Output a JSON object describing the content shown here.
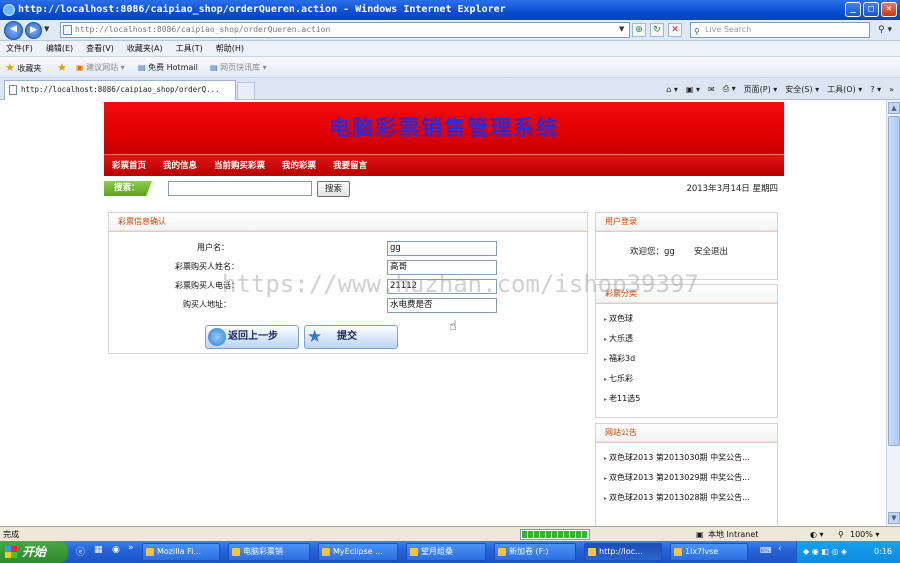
{
  "window": {
    "title": "http://localhost:8086/caipiao_shop/orderQueren.action - Windows Internet Explorer",
    "address": "http://localhost:8086/caipiao_shop/orderQueren.action",
    "search_placeholder": "Live Search"
  },
  "menu": [
    "文件(F)",
    "编辑(E)",
    "查看(V)",
    "收藏夹(A)",
    "工具(T)",
    "帮助(H)"
  ],
  "favorites": {
    "label": "收藏夹",
    "items": [
      "建议网站 ▾",
      "免费 Hotmail",
      "网页快讯库 ▾"
    ]
  },
  "tab": {
    "title": "http://localhost:8086/caipiao_shop/orderQ..."
  },
  "commands": [
    "页面(P) ▾",
    "安全(S) ▾",
    "工具(O) ▾"
  ],
  "site": {
    "title": "电脑彩票销售管理系统",
    "nav": [
      "彩票首页",
      "我的信息",
      "当前购买彩票",
      "我的彩票",
      "我要留言"
    ],
    "search_label": "搜索：",
    "search_button": "搜索",
    "date": "2013年3月14日 星期四"
  },
  "order_panel": {
    "title": "彩票信息确认",
    "fields": [
      {
        "label": "用户名：",
        "value": "gg"
      },
      {
        "label": "彩票购买人姓名：",
        "value": "高哥"
      },
      {
        "label": "彩票购买人电话：",
        "value": "21112"
      },
      {
        "label": "购买人地址：",
        "value": "水电费是否"
      }
    ],
    "back_button": "返回上一步",
    "submit_button": "提交"
  },
  "login_panel": {
    "title": "用户登录",
    "welcome": "欢迎您：gg",
    "logout": "安全退出"
  },
  "category_panel": {
    "title": "彩票分类",
    "items": [
      "双色球",
      "大乐透",
      "福彩3d",
      "七乐彩",
      "老11选5"
    ]
  },
  "notice_panel": {
    "title": "网站公告",
    "items": [
      "双色球2013 第2013030期 中奖公告...",
      "双色球2013 第2013029期 中奖公告...",
      "双色球2013 第2013028期 中奖公告..."
    ]
  },
  "watermark": "https://www.huzhan.com/ishop39397",
  "status": {
    "left": "完成",
    "zone": "本地 Intranet",
    "zoom": "100% ▾"
  },
  "taskbar": {
    "start": "开始",
    "tasks": [
      "Mozilla Fi...",
      "电脑彩票销",
      "MyEclipse ...",
      "望月组桑",
      "新加卷 (F:)",
      "http://loc...",
      "1lx7lvse"
    ],
    "clock": "0:16"
  }
}
